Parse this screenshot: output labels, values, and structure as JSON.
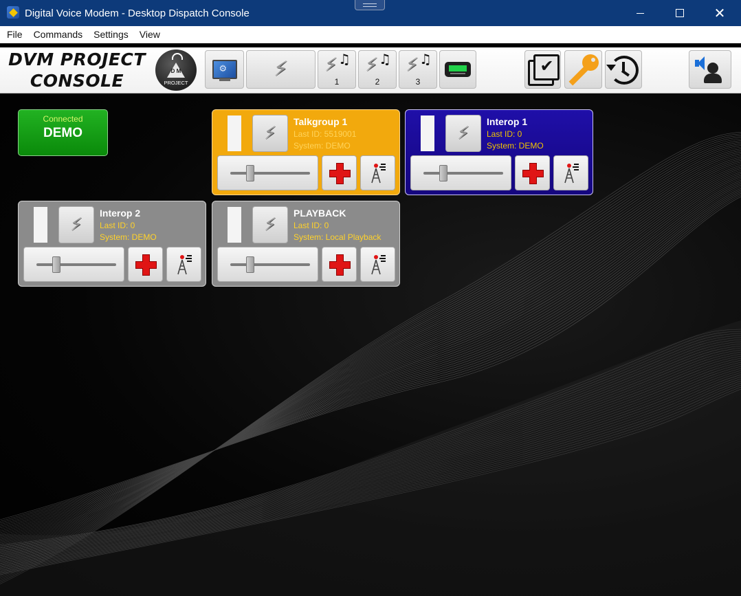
{
  "window": {
    "title": "Digital Voice Modem - Desktop Dispatch Console",
    "minimize_glyph": "",
    "maximize_glyph": "",
    "close_glyph": "✕"
  },
  "menu": {
    "items": [
      "File",
      "Commands",
      "Settings",
      "View"
    ]
  },
  "toolbar": {
    "brand_line1": "DVM  PROJECT",
    "brand_line2": "CONSOLE",
    "logo_text_top": "D  M",
    "logo_text_bottom": "PROJECT",
    "buttons": [
      {
        "icon": "monitor-settings-icon"
      },
      {
        "icon": "lightning-icon"
      },
      {
        "icon": "lightning-tone-icon",
        "label": "1"
      },
      {
        "icon": "lightning-tone-icon",
        "label": "2"
      },
      {
        "icon": "lightning-tone-icon",
        "label": "3"
      },
      {
        "icon": "pager-icon"
      },
      {
        "icon": "select-all-icon"
      },
      {
        "icon": "key-icon"
      },
      {
        "icon": "history-icon"
      },
      {
        "icon": "speaker-user-icon"
      }
    ]
  },
  "connection": {
    "status": "Connected",
    "system": "DEMO",
    "color": "#1aa51a"
  },
  "channels": [
    {
      "name": "Talkgroup 1",
      "last_id": "Last ID: 5519001",
      "system": "System: DEMO",
      "color": "#f2a90d",
      "volume": 0.22
    },
    {
      "name": "Interop 1",
      "last_id": "Last ID: 0",
      "system": "System: DEMO",
      "color": "#1a0c96",
      "volume": 0.22
    },
    {
      "name": "Interop 2",
      "last_id": "Last ID: 0",
      "system": "System: DEMO",
      "color": "#8b8b8b",
      "volume": 0.22
    },
    {
      "name": "PLAYBACK",
      "last_id": "Last ID: 0",
      "system": "System: Local Playback",
      "color": "#8b8b8b",
      "volume": 0.22
    }
  ],
  "icons": {
    "ptt": "lightning-icon",
    "bolt_glyph": "⚡",
    "note_glyph": "♫",
    "gear_glyph": "⚙",
    "check_glyph": "✔"
  }
}
